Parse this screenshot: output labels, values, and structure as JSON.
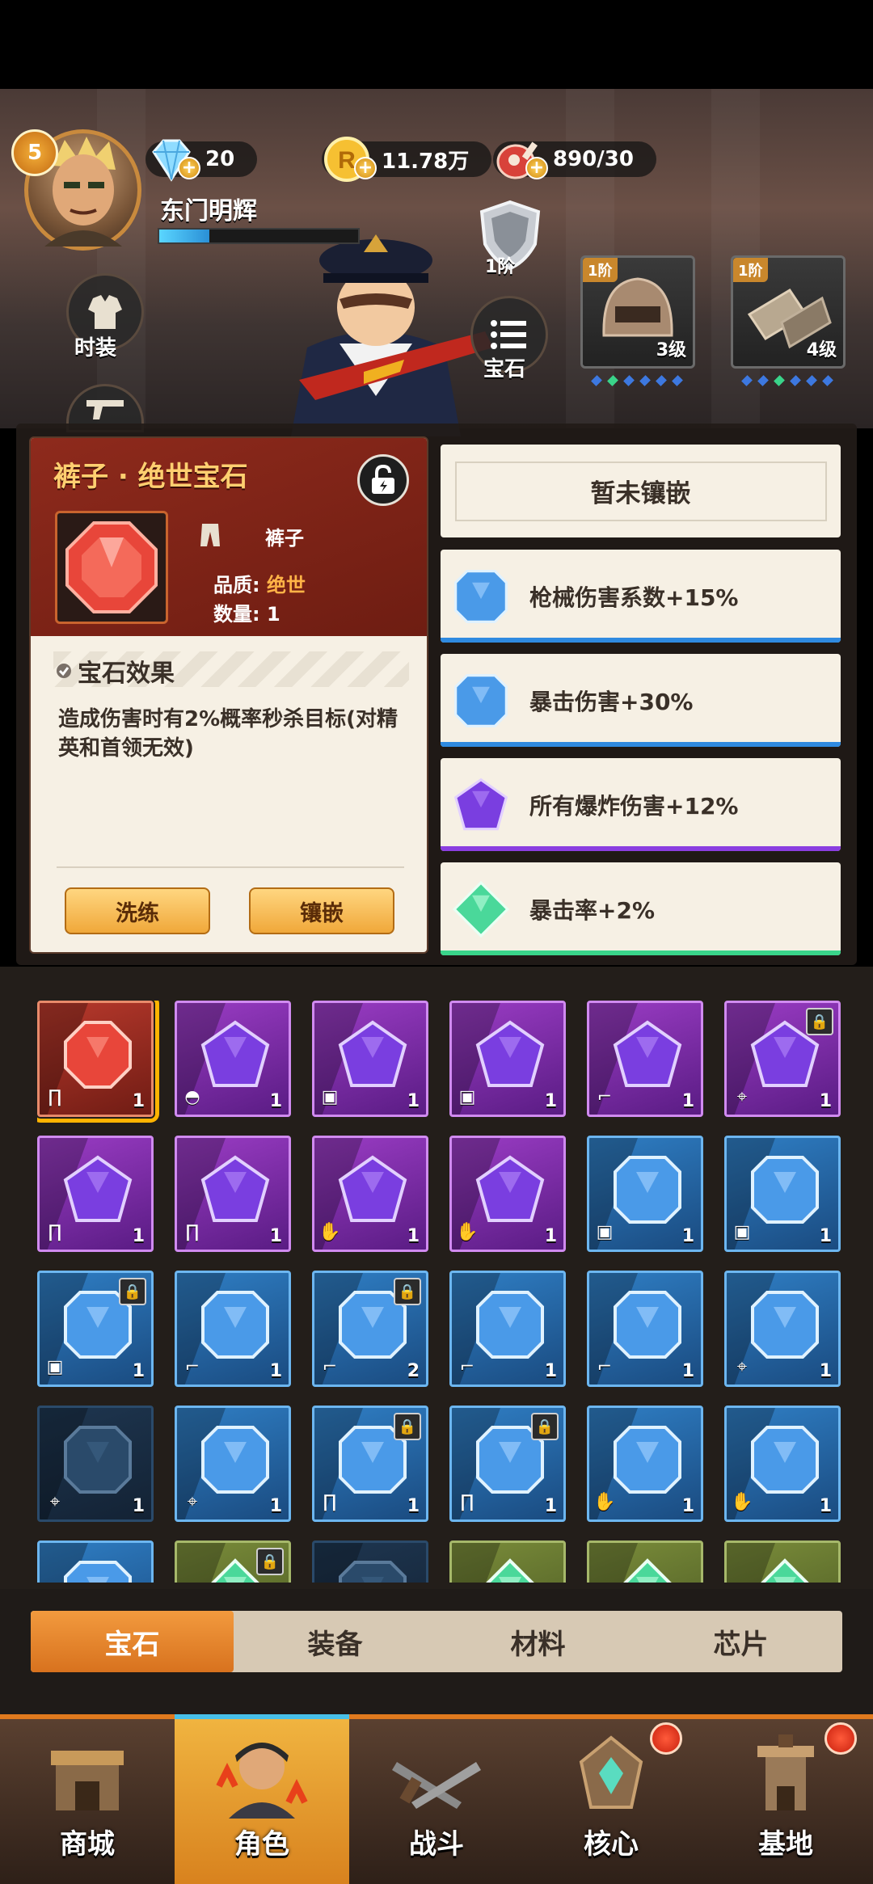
{
  "player": {
    "level": "5",
    "name": "东门明辉",
    "xp_fraction": 0.25
  },
  "resources": [
    {
      "icon": "diamond-icon",
      "value": "20"
    },
    {
      "icon": "gold-coin-icon",
      "value": "11.78万"
    },
    {
      "icon": "meat-icon",
      "value": "890/30"
    }
  ],
  "side_buttons": {
    "outfit": "时装",
    "gem": "宝石"
  },
  "tier": "1阶",
  "equipment": [
    {
      "tier": "1阶",
      "level": "3级",
      "icon": "helmet-icon"
    },
    {
      "tier": "1阶",
      "level": "4级",
      "icon": "gauntlet-icon"
    }
  ],
  "gem_card": {
    "title": "裤子 · 绝世宝石",
    "slot_label": "裤子",
    "quality_key": "品质:",
    "quality_value": "绝世",
    "count_key": "数量:",
    "count_value": "1",
    "effect_title": "宝石效果",
    "effect_text": "造成伤害时有2%概率秒杀目标(对精英和首领无效)",
    "refine_label": "洗练",
    "inlay_label": "镶嵌"
  },
  "inlay_slots": {
    "empty_label": "暂未镶嵌",
    "stats": [
      {
        "text": "枪械伤害系数+15%",
        "color": "blue"
      },
      {
        "text": "暴击伤害+30%",
        "color": "blue"
      },
      {
        "text": "所有爆炸伤害+12%",
        "color": "purple"
      },
      {
        "text": "暴击率+2%",
        "color": "green"
      }
    ]
  },
  "grid": [
    {
      "color": "red",
      "part": "pants",
      "count": "1",
      "selected": true
    },
    {
      "color": "purple",
      "part": "helmet",
      "count": "1"
    },
    {
      "color": "purple",
      "part": "armor",
      "count": "1"
    },
    {
      "color": "purple",
      "part": "armor",
      "count": "1"
    },
    {
      "color": "purple",
      "part": "boots",
      "count": "1"
    },
    {
      "color": "purple",
      "part": "gun",
      "count": "1",
      "locked": true
    },
    {
      "color": "purple",
      "part": "pants",
      "count": "1"
    },
    {
      "color": "purple",
      "part": "pants",
      "count": "1"
    },
    {
      "color": "purple",
      "part": "glove",
      "count": "1"
    },
    {
      "color": "purple",
      "part": "glove",
      "count": "1"
    },
    {
      "color": "blue",
      "part": "armor",
      "count": "1"
    },
    {
      "color": "blue",
      "part": "armor",
      "count": "1"
    },
    {
      "color": "blue",
      "part": "armor",
      "count": "1",
      "locked": true
    },
    {
      "color": "blue",
      "part": "boots",
      "count": "1"
    },
    {
      "color": "blue",
      "part": "boots",
      "count": "2",
      "locked": true
    },
    {
      "color": "blue",
      "part": "boots",
      "count": "1"
    },
    {
      "color": "blue",
      "part": "boots",
      "count": "1"
    },
    {
      "color": "blue",
      "part": "gun",
      "count": "1"
    },
    {
      "color": "dim",
      "part": "gun",
      "count": "1"
    },
    {
      "color": "blue",
      "part": "gun",
      "count": "1"
    },
    {
      "color": "blue",
      "part": "pants",
      "count": "1",
      "locked": true
    },
    {
      "color": "blue",
      "part": "pants",
      "count": "1",
      "locked": true
    },
    {
      "color": "blue",
      "part": "glove",
      "count": "1"
    },
    {
      "color": "blue",
      "part": "glove",
      "count": "1"
    },
    {
      "color": "blue",
      "part": "",
      "count": ""
    },
    {
      "color": "green",
      "part": "",
      "count": "",
      "locked": true
    },
    {
      "color": "dim",
      "part": "",
      "count": ""
    },
    {
      "color": "green",
      "part": "",
      "count": ""
    },
    {
      "color": "green",
      "part": "",
      "count": ""
    },
    {
      "color": "green",
      "part": "",
      "count": ""
    }
  ],
  "tabs": [
    {
      "label": "宝石",
      "active": true
    },
    {
      "label": "装备"
    },
    {
      "label": "材料"
    },
    {
      "label": "芯片"
    }
  ],
  "nav": [
    {
      "label": "商城",
      "icon": "shop-building-icon"
    },
    {
      "label": "角色",
      "icon": "character-icon",
      "active": true
    },
    {
      "label": "战斗",
      "icon": "crossed-guns-icon"
    },
    {
      "label": "核心",
      "icon": "core-crystal-icon",
      "badge": true
    },
    {
      "label": "基地",
      "icon": "base-tower-icon",
      "badge": true
    }
  ],
  "colors": {
    "accent_orange": "#e07a1e",
    "gem_red": "#b8392c",
    "gem_purple": "#9a3cc4",
    "gem_blue": "#2f7ec4",
    "gem_green": "#3ad48a"
  }
}
